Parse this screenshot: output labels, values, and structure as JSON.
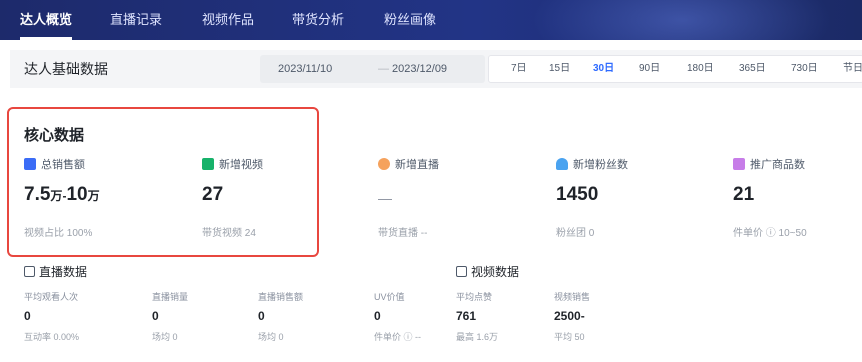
{
  "nav": {
    "tabs": [
      "达人概览",
      "直播记录",
      "视频作品",
      "带货分析",
      "粉丝画像"
    ]
  },
  "filter": {
    "title": "达人基础数据",
    "date_start": "2023/11/10",
    "date_sep": "—",
    "date_end": "2023/12/09",
    "periods": [
      "7日",
      "15日",
      "30日",
      "90日",
      "180日",
      "365日",
      "730日",
      "节日"
    ],
    "active_period": "30日"
  },
  "core": {
    "title": "核心数据",
    "metrics": [
      {
        "label": "总销售额",
        "value_a": "7.5",
        "unit_a": "万",
        "sep": "-",
        "value_b": "10",
        "unit_b": "万",
        "sub": "视频占比 100%",
        "icon": "sales-icon",
        "color": "#3b6cf6"
      },
      {
        "label": "新增视频",
        "value": "27",
        "sub": "带货视频 24",
        "icon": "video-icon",
        "color": "#17b26a"
      },
      {
        "label": "新增直播",
        "value": "—",
        "sub": "带货直播 --",
        "icon": "live-icon",
        "color": "#f5a25d"
      },
      {
        "label": "新增粉丝数",
        "value": "1450",
        "sub": "粉丝团 0",
        "icon": "fans-icon",
        "color": "#4aa3f0"
      },
      {
        "label": "推广商品数",
        "value": "21",
        "sub": "件单价 ⓘ 10~50",
        "icon": "product-icon",
        "color": "#c77de8"
      }
    ]
  },
  "live": {
    "title": "直播数据",
    "cells": [
      {
        "label": "平均观看人次",
        "value": "0",
        "sub": "互动率 0.00%"
      },
      {
        "label": "直播销量",
        "value": "0",
        "sub": "场均 0"
      },
      {
        "label": "直播销售额",
        "value": "0",
        "sub": "场均 0"
      },
      {
        "label": "UV价值",
        "value": "0",
        "sub": "件单价 ⓘ --"
      }
    ]
  },
  "video": {
    "title": "视频数据",
    "cells": [
      {
        "label": "平均点赞",
        "value": "761",
        "sub": "最高 1.6万"
      },
      {
        "label": "视频销售",
        "value": "2500-",
        "sub": "平均 50"
      }
    ]
  }
}
